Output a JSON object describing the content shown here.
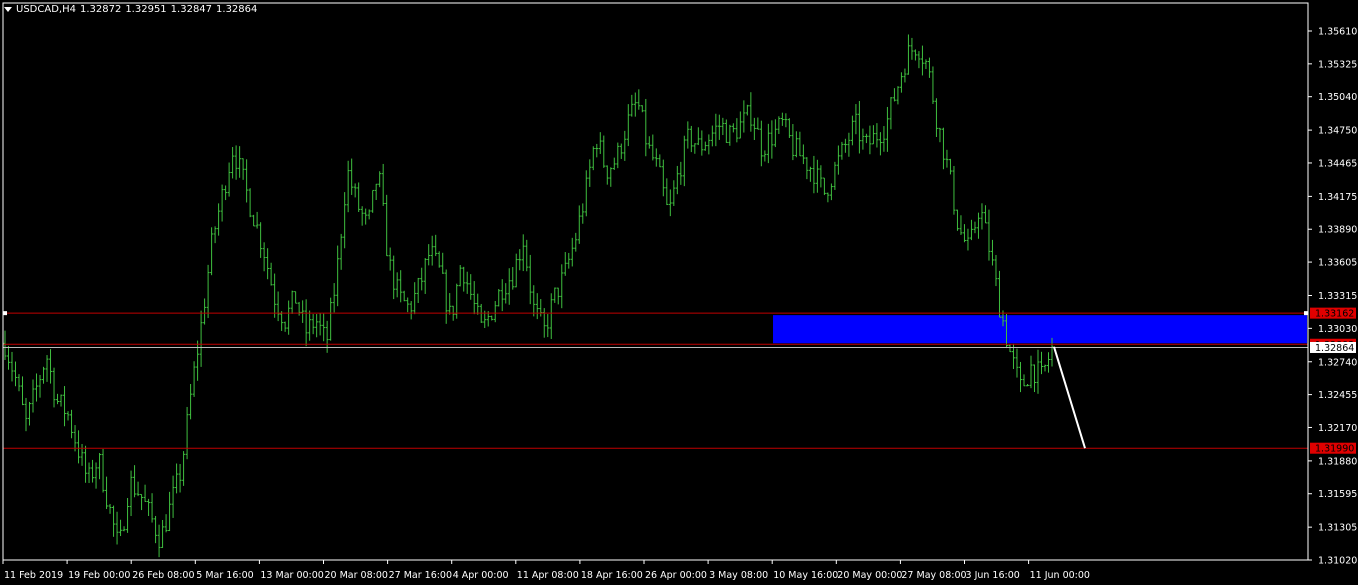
{
  "header": {
    "symbol": "USDCAD,H4",
    "open": "1.32872",
    "high": "1.32951",
    "low": "1.32847",
    "close": "1.32864"
  },
  "colors": {
    "background": "#000000",
    "frame": "#ffffff",
    "candle": "#3fbf3f",
    "level_line": "#c00000",
    "level_label_bg": "#e00000",
    "zone": "#0000ff",
    "arrow": "#ffffff",
    "text": "#ffffff"
  },
  "chart_data": {
    "type": "line",
    "symbol": "USDCAD",
    "timeframe": "H4",
    "y_tick_labels": [
      "1.35610",
      "1.35325",
      "1.35040",
      "1.34750",
      "1.34465",
      "1.34175",
      "1.33890",
      "1.33605",
      "1.33315",
      "1.33030",
      "1.32740",
      "1.32455",
      "1.32170",
      "1.31880",
      "1.31595",
      "1.31305",
      "1.31020"
    ],
    "ylim": [
      1.3102,
      1.3561
    ],
    "x_tick_labels": [
      "11 Feb 2019",
      "19 Feb 00:00",
      "26 Feb 08:00",
      "5 Mar 16:00",
      "13 Mar 00:00",
      "20 Mar 08:00",
      "27 Mar 16:00",
      "4 Apr 00:00",
      "11 Apr 08:00",
      "18 Apr 16:00",
      "26 Apr 00:00",
      "3 May 08:00",
      "10 May 16:00",
      "20 May 00:00",
      "27 May 08:00",
      "3 Jun 16:00",
      "11 Jun 00:00"
    ],
    "series": [
      {
        "values": [
          1.329,
          1.326,
          1.322,
          1.325,
          1.328,
          1.324,
          1.323,
          1.32,
          1.317,
          1.319,
          1.315,
          1.311,
          1.317,
          1.316,
          1.314,
          1.312,
          1.315,
          1.318,
          1.325,
          1.331,
          1.338,
          1.342,
          1.346,
          1.343,
          1.34,
          1.337,
          1.333,
          1.331,
          1.333,
          1.33,
          1.331,
          1.329,
          1.335,
          1.344,
          1.341,
          1.339,
          1.344,
          1.336,
          1.333,
          1.332,
          1.334,
          1.337,
          1.335,
          1.331,
          1.336,
          1.333,
          1.33,
          1.332,
          1.334,
          1.335,
          1.338,
          1.332,
          1.33,
          1.333,
          1.335,
          1.338,
          1.342,
          1.347,
          1.344,
          1.345,
          1.348,
          1.35,
          1.346,
          1.344,
          1.34,
          1.344,
          1.347,
          1.346,
          1.347,
          1.348,
          1.347,
          1.348,
          1.349,
          1.346,
          1.347,
          1.348,
          1.346,
          1.345,
          1.344,
          1.342,
          1.344,
          1.346,
          1.348,
          1.346,
          1.347,
          1.348,
          1.351,
          1.354,
          1.355,
          1.353,
          1.348,
          1.344,
          1.339,
          1.337,
          1.341,
          1.337,
          1.332,
          1.328,
          1.325,
          1.327,
          1.326,
          1.3285
        ]
      }
    ],
    "levels": [
      {
        "value": 1.33162,
        "label": "1.33162"
      },
      {
        "value": 1.32892,
        "label": "1.32892"
      },
      {
        "value": 1.32864,
        "label": "1.32864"
      },
      {
        "value": 1.3199,
        "label": "1.31990"
      }
    ],
    "zone": {
      "from": "10 May 16:00",
      "price_top": 1.33162,
      "price_bottom": 1.32892
    },
    "arrow": {
      "from_price": 1.3287,
      "to_price": 1.3199
    }
  }
}
